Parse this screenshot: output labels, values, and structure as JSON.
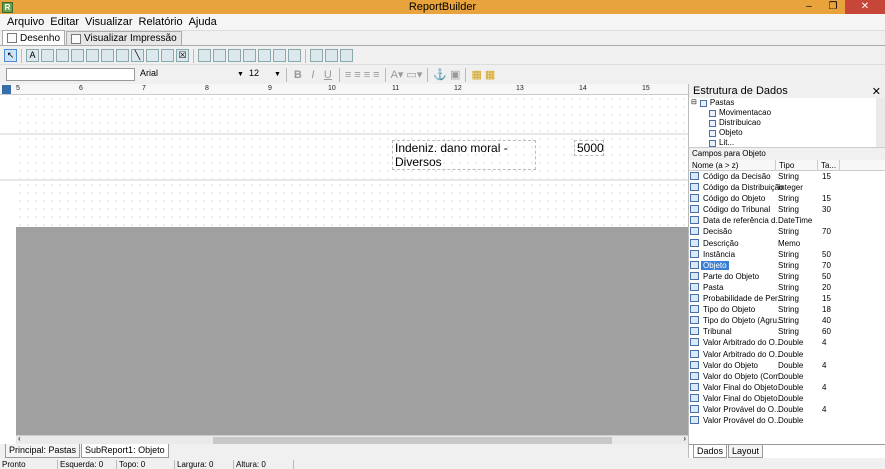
{
  "window": {
    "title": "ReportBuilder"
  },
  "menu": [
    "Arquivo",
    "Editar",
    "Visualizar",
    "Relatório",
    "Ajuda"
  ],
  "tabs": [
    {
      "label": "Desenho"
    },
    {
      "label": "Visualizar Impressão"
    }
  ],
  "toolbar": {
    "font_name": "Arial",
    "font_size": "12",
    "bold": "B",
    "italic": "I",
    "underline": "U"
  },
  "ruler": {
    "labels": [
      "5",
      "6",
      "7",
      "8",
      "9",
      "10",
      "11",
      "12",
      "13",
      "14",
      "15"
    ]
  },
  "report": {
    "field_text": "Indeniz. dano moral - Diversos",
    "field_value": "5000"
  },
  "bottom_tabs": [
    "Principal: Pastas",
    "SubReport1: Objeto"
  ],
  "status": [
    "Pronto",
    "Esquerda: 0",
    "Topo: 0",
    "Largura: 0",
    "Altura: 0"
  ],
  "panel": {
    "title": "Estrutura de Dados",
    "close": "✕",
    "tree": [
      "Pastas",
      "Movimentacao",
      "Distribuicao",
      "Objeto",
      "Lit..."
    ],
    "fields_label": "Campos para Objeto",
    "columns": [
      "Nome (a > z)",
      "Tipo",
      "Ta..."
    ],
    "fields": [
      {
        "name": "Código da Decisão",
        "type": "String",
        "size": "15"
      },
      {
        "name": "Código da Distribuição",
        "type": "Integer",
        "size": ""
      },
      {
        "name": "Código do Objeto",
        "type": "String",
        "size": "15"
      },
      {
        "name": "Código do Tribunal",
        "type": "String",
        "size": "30"
      },
      {
        "name": "Data de referência d...",
        "type": "DateTime",
        "size": ""
      },
      {
        "name": "Decisão",
        "type": "String",
        "size": "70"
      },
      {
        "name": "Descrição",
        "type": "Memo",
        "size": ""
      },
      {
        "name": "Instância",
        "type": "String",
        "size": "50"
      },
      {
        "name": "Objeto",
        "type": "String",
        "size": "70"
      },
      {
        "name": "Parte do Objeto",
        "type": "String",
        "size": "50"
      },
      {
        "name": "Pasta",
        "type": "String",
        "size": "20"
      },
      {
        "name": "Probabilidade de Per...",
        "type": "String",
        "size": "15"
      },
      {
        "name": "Tipo do Objeto",
        "type": "String",
        "size": "18"
      },
      {
        "name": "Tipo do Objeto (Agru...",
        "type": "String",
        "size": "40"
      },
      {
        "name": "Tribunal",
        "type": "String",
        "size": "60"
      },
      {
        "name": "Valor Arbitrado do O...",
        "type": "Double",
        "size": "4"
      },
      {
        "name": "Valor Arbitrado do O...",
        "type": "Double",
        "size": ""
      },
      {
        "name": "Valor do Objeto",
        "type": "Double",
        "size": "4"
      },
      {
        "name": "Valor do Objeto (Corr...",
        "type": "Double",
        "size": ""
      },
      {
        "name": "Valor Final do Objeto",
        "type": "Double",
        "size": "4"
      },
      {
        "name": "Valor Final do Objeto...",
        "type": "Double",
        "size": ""
      },
      {
        "name": "Valor Provável do O...",
        "type": "Double",
        "size": "4"
      },
      {
        "name": "Valor Provável do O...",
        "type": "Double",
        "size": ""
      }
    ],
    "selected_field": "Objeto",
    "tabs": [
      "Dados",
      "Layout"
    ]
  },
  "colors": {
    "titlebar": "#e8a33d",
    "selection": "#3b7fd4"
  }
}
